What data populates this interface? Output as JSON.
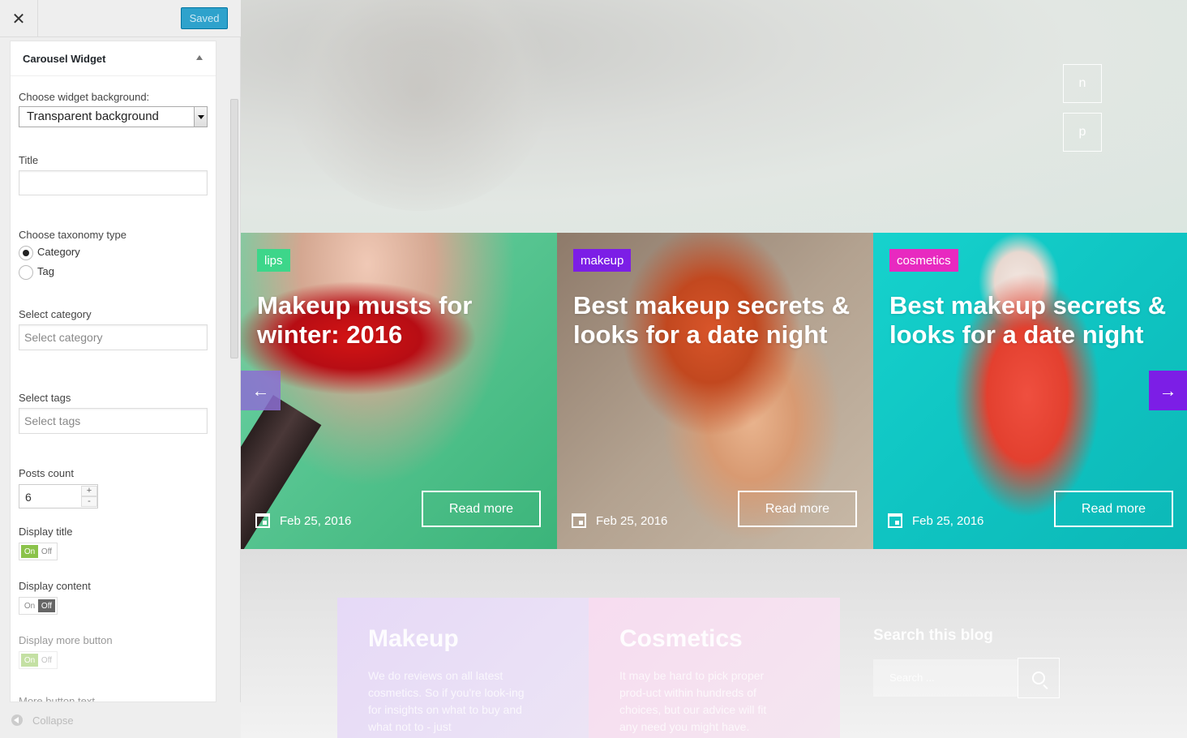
{
  "header": {
    "close_icon": "close-icon",
    "saved_label": "Saved"
  },
  "widget": {
    "title": "Carousel Widget",
    "background_label": "Choose widget background:",
    "background_value": "Transparent background",
    "title_label": "Title",
    "title_value": "",
    "taxonomy_label": "Choose taxonomy type",
    "taxonomy_options": [
      "Category",
      "Tag"
    ],
    "taxonomy_selected": "Category",
    "category_label": "Select category",
    "category_placeholder": "Select category",
    "tags_label": "Select tags",
    "tags_placeholder": "Select tags",
    "count_label": "Posts count",
    "count_value": "6",
    "display_title_label": "Display title",
    "display_content_label": "Display content",
    "display_more_label": "Display more button",
    "more_text_label": "More button text",
    "toggle_on": "On",
    "toggle_off": "Off"
  },
  "footer": {
    "collapse_label": "Collapse"
  },
  "preview": {
    "hero_buttons": [
      "n",
      "p"
    ],
    "cards": [
      {
        "tag": "lips",
        "tag_color": "#3dd68a",
        "title": "Makeup musts for winter: 2016",
        "date": "Feb 25, 2016",
        "button": "Read more"
      },
      {
        "tag": "makeup",
        "tag_color": "#7c1ee6",
        "title": "Best makeup secrets & looks for a date night",
        "date": "Feb 25, 2016",
        "button": "Read more"
      },
      {
        "tag": "cosmetics",
        "tag_color": "#e829c0",
        "title": "Best makeup secrets & looks for a date night",
        "date": "Feb 25, 2016",
        "button": "Read more"
      }
    ],
    "lower": [
      {
        "title": "Makeup",
        "text": "We do reviews on all latest cosmetics. So if you're look-ing for insights on what to buy and what not to - just"
      },
      {
        "title": "Cosmetics",
        "text": "It may be hard to pick proper prod-uct within hundreds of choices, but our advice will fit any need you might have."
      }
    ],
    "search_title": "Search this blog",
    "search_placeholder": "Search ..."
  }
}
